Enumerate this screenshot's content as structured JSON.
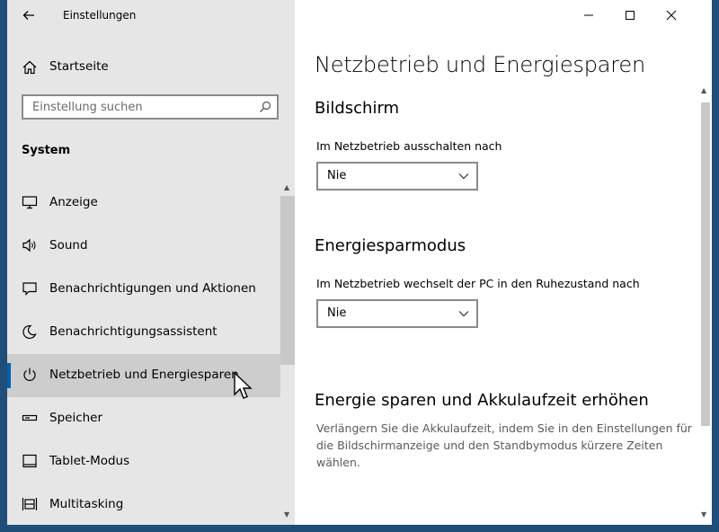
{
  "window": {
    "title": "Einstellungen"
  },
  "sidebar": {
    "home_label": "Startseite",
    "search_placeholder": "Einstellung suchen",
    "section_title": "System",
    "items": [
      {
        "label": "Anzeige",
        "icon": "monitor-icon"
      },
      {
        "label": "Sound",
        "icon": "speaker-icon"
      },
      {
        "label": "Benachrichtigungen und Aktionen",
        "icon": "notification-icon"
      },
      {
        "label": "Benachrichtigungsassistent",
        "icon": "moon-icon"
      },
      {
        "label": "Netzbetrieb und Energiesparen",
        "icon": "power-icon",
        "selected": true
      },
      {
        "label": "Speicher",
        "icon": "storage-icon"
      },
      {
        "label": "Tablet-Modus",
        "icon": "tablet-icon"
      },
      {
        "label": "Multitasking",
        "icon": "multitasking-icon"
      }
    ]
  },
  "main": {
    "title": "Netzbetrieb und Energiesparen",
    "screen": {
      "heading": "Bildschirm",
      "label": "Im Netzbetrieb ausschalten nach",
      "value": "Nie"
    },
    "sleep": {
      "heading": "Energiesparmodus",
      "label": "Im Netzbetrieb wechselt der PC in den Ruhezustand nach",
      "value": "Nie"
    },
    "battery": {
      "heading": "Energie sparen und Akkulaufzeit erhöhen",
      "description": "Verlängern Sie die Akkulaufzeit, indem Sie in den Einstellungen für die Bildschirmanzeige und den Standbymodus kürzere Zeiten wählen."
    }
  },
  "colors": {
    "accent": "#0063b1",
    "sidebar_bg": "#e6e6e6",
    "selected_bg": "#cdcdcd",
    "desktop_bg": "#1f4e79"
  }
}
